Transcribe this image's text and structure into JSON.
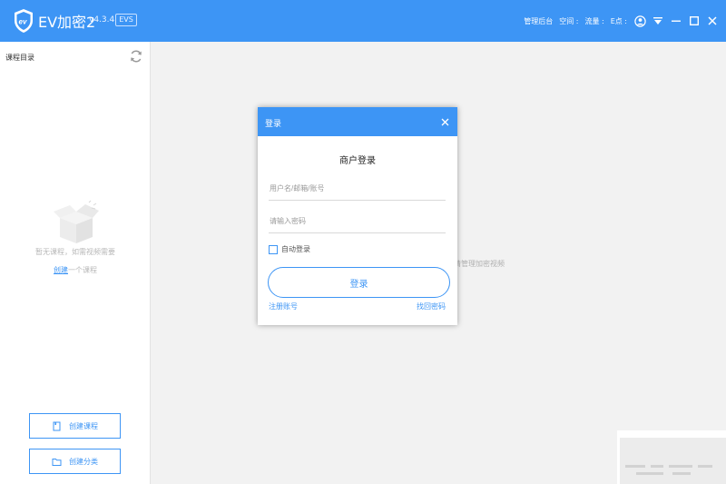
{
  "app": {
    "title": "EV加密2",
    "version": "v4.3.4",
    "edition": "EVS",
    "logo_icon": "ev-shield-logo-icon"
  },
  "topbar": {
    "admin_label": "管理后台",
    "space_label": "空间 :",
    "traffic_label": "流量 :",
    "points_label": "E点 :"
  },
  "sidebar": {
    "title": "课程目录",
    "empty_text": "暂无课程，如需视频需要",
    "create_link": "创建",
    "create_suffix": "一个课程",
    "create_course_button": "创建课程",
    "create_category_button": "创建分类"
  },
  "main": {
    "hint": "请管理加密视频"
  },
  "dialog": {
    "title": "登录",
    "heading": "商户登录",
    "username_placeholder": "用户名/邮箱/账号",
    "password_placeholder": "请输入密码",
    "auto_login_label": "自动登录",
    "login_button": "登录",
    "register_link": "注册账号",
    "forgot_link": "找回密码"
  },
  "colors": {
    "accent": "#3d95f5",
    "background": "#f2f2f2",
    "sidebar": "#ffffff"
  }
}
